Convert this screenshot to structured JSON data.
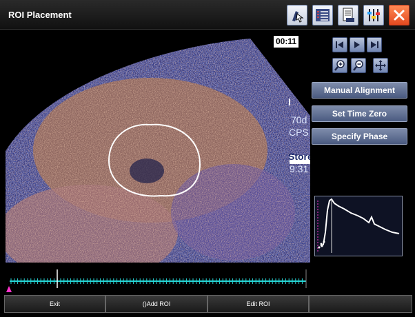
{
  "window": {
    "title": "ROI Placement"
  },
  "toolbar": {
    "icons": [
      "select-tool-icon",
      "list-icon",
      "document-icon",
      "settings-icon",
      "close-icon"
    ]
  },
  "viewer": {
    "timer": "00:11",
    "overlay": [
      "70d",
      "CPS",
      "Store",
      "9:31"
    ]
  },
  "navigation": {
    "buttons": [
      "first-frame-icon",
      "play-icon",
      "last-frame-icon"
    ],
    "zoom": [
      "zoom-in-icon",
      "zoom-out-icon",
      "pan-icon"
    ]
  },
  "actions": {
    "manual_alignment": "Manual Alignment",
    "set_time_zero": "Set Time Zero",
    "specify_phase": "Specify Phase"
  },
  "bottom": {
    "exit": "Exit",
    "add_roi": "()Add ROI",
    "edit_roi": "Edit ROI",
    "empty": ""
  },
  "colors": {
    "tissue_blue": "#3a4aa8",
    "tissue_orange": "#c48a5a",
    "timeline": "#27d7d7",
    "marker": "#ff33cc",
    "curve": "#ffffff"
  }
}
